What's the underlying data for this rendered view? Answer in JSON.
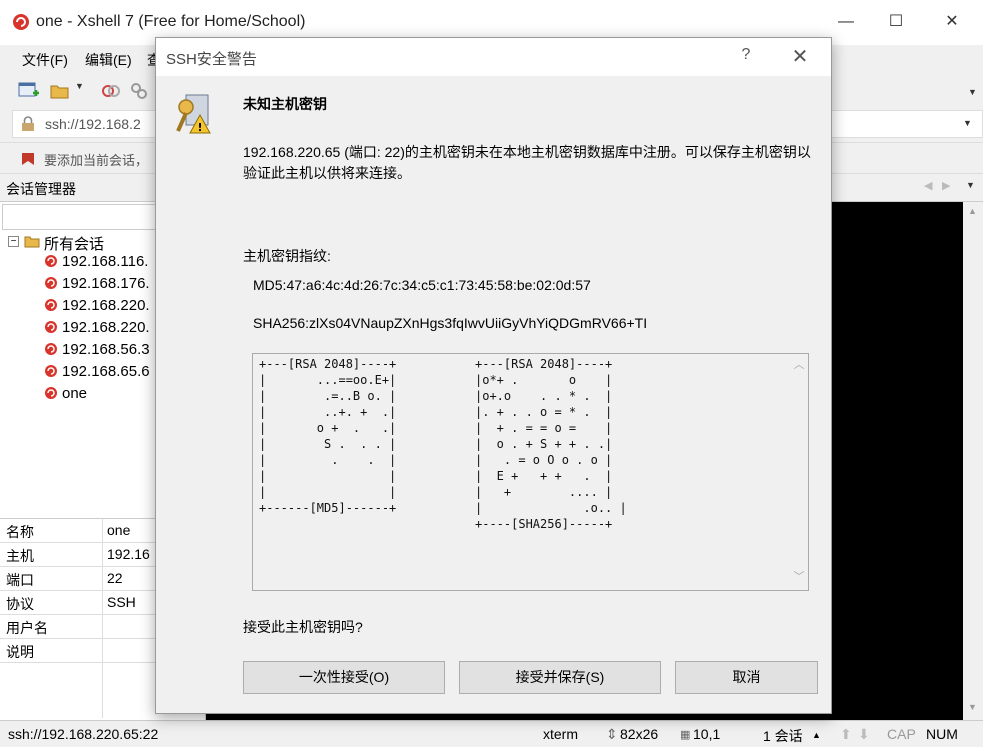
{
  "window": {
    "title": "one - Xshell 7 (Free for Home/School)",
    "minimize": "—",
    "maximize": "☐",
    "close": "✕"
  },
  "menu": {
    "file": "文件(F)",
    "edit": "编辑(E)",
    "view": "查"
  },
  "address": {
    "value": "ssh://192.168.2"
  },
  "infobar": {
    "text": "要添加当前会话，"
  },
  "session_manager": {
    "title": "会话管理器",
    "root": "所有会话",
    "items": [
      "192.168.116.",
      "192.168.176.",
      "192.168.220.",
      "192.168.220.",
      "192.168.56.3",
      "192.168.65.6",
      "one"
    ]
  },
  "properties": [
    {
      "key": "名称",
      "value": "one"
    },
    {
      "key": "主机",
      "value": "192.16"
    },
    {
      "key": "端口",
      "value": "22"
    },
    {
      "key": "协议",
      "value": "SSH"
    },
    {
      "key": "用户名",
      "value": ""
    },
    {
      "key": "说明",
      "value": ""
    }
  ],
  "status": {
    "connection": "ssh://192.168.220.65:22",
    "terminal": "xterm",
    "size": "82x26",
    "cursor": "10,1",
    "sessions": "1 会话",
    "cap": "CAP",
    "num": "NUM"
  },
  "dialog": {
    "title": "SSH安全警告",
    "help": "?",
    "close": "✕",
    "heading": "未知主机密钥",
    "message": "192.168.220.65 (端口: 22)的主机密钥未在本地主机密钥数据库中注册。可以保存主机密钥以验证此主机以供将来连接。",
    "fingerprint_label": "主机密钥指纹:",
    "md5": "MD5:47:a6:4c:4d:26:7c:34:c5:c1:73:45:58:be:02:0d:57",
    "sha256": "SHA256:zlXs04VNaupZXnHgs3fqIwvUiiGyVhYiQDGmRV66+TI",
    "randomart_md5": "+---[RSA 2048]----+\n|       ...==oo.E+|\n|        .=..B o. |\n|        ..+. +  .|\n|       o +  .   .|\n|        S .  . . |\n|         .    .  |\n|                 |\n|                 |\n+------[MD5]------+",
    "randomart_sha256": "+---[RSA 2048]----+\n|o*+ .       o    |\n|o+.o    . . * .  |\n|. + . . o = * .  |\n|  + . = = o =    |\n|  o . + S + + . .|\n|   . = o O o . o |\n|  E +   + +   .  |\n|   +        .... |\n|              .o.. |\n+----[SHA256]-----+",
    "question": "接受此主机密钥吗?",
    "buttons": {
      "accept_once": "一次性接受(O)",
      "accept_save": "接受并保存(S)",
      "cancel": "取消"
    }
  },
  "colors": {
    "terminal_bg": "#000000",
    "dialog_bg": "#f0f0f0",
    "button_bg": "#e1e1e1",
    "xshell_red": "#d9342b"
  }
}
